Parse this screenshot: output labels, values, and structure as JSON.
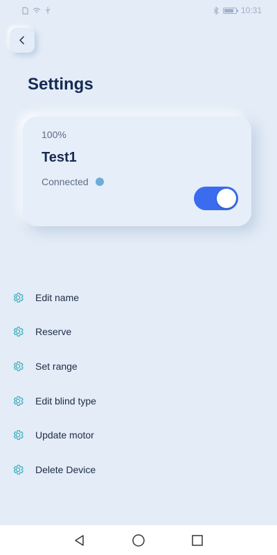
{
  "status_bar": {
    "time": "10:31",
    "icons_left": [
      "sim-icon",
      "wifi-signal-icon",
      "usb-icon"
    ],
    "icons_right": [
      "bluetooth-icon",
      "battery-icon"
    ]
  },
  "header": {
    "back_icon": "chevron-left-icon",
    "title": "Settings"
  },
  "device_card": {
    "percent": "100%",
    "name": "Test1",
    "status": "Connected",
    "status_dot_color": "#6aaed8",
    "toggle_on": true,
    "toggle_color": "#3b6cf0"
  },
  "menu": {
    "icon": "gear-icon",
    "icon_color": "#2aa7b5",
    "items": [
      {
        "label": "Edit name"
      },
      {
        "label": "Reserve"
      },
      {
        "label": "Set range"
      },
      {
        "label": "Edit blind type"
      },
      {
        "label": "Update motor"
      },
      {
        "label": "Delete Device"
      }
    ]
  },
  "nav_bar": {
    "buttons": [
      "back-triangle-icon",
      "home-circle-icon",
      "recents-square-icon"
    ]
  }
}
